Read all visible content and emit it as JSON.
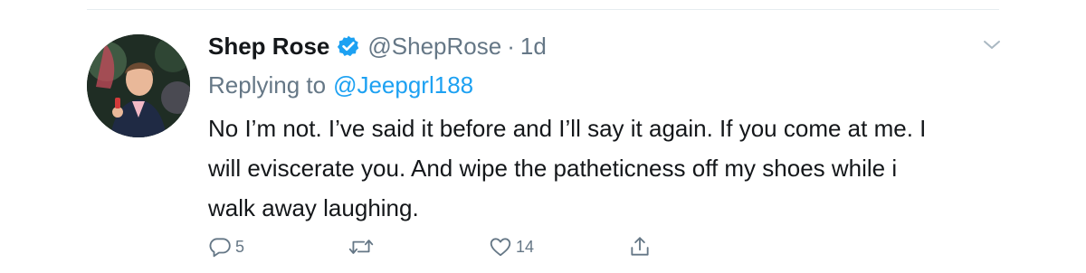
{
  "tweet": {
    "author": {
      "display_name": "Shep Rose",
      "handle": "@ShepRose",
      "verified": true
    },
    "separator": "·",
    "timestamp": "1d",
    "replying_prefix": "Replying to",
    "replying_to": "@Jeepgrl188",
    "text_lines": [
      "No I’m not. I’ve said it before and I’ll say it again. If you come at me. I",
      "will eviscerate you. And wipe the patheticness off my shoes while i",
      "walk away laughing."
    ],
    "actions": {
      "reply_count": "5",
      "retweet_count": "",
      "like_count": "14"
    }
  },
  "icons": {
    "verified": "verified-badge-icon",
    "menu": "chevron-down-icon",
    "reply": "reply-icon",
    "retweet": "retweet-icon",
    "like": "heart-icon",
    "share": "share-icon"
  },
  "colors": {
    "text": "#14171a",
    "secondary": "#657786",
    "link": "#1da1f2",
    "divider": "#e6ecf0"
  }
}
